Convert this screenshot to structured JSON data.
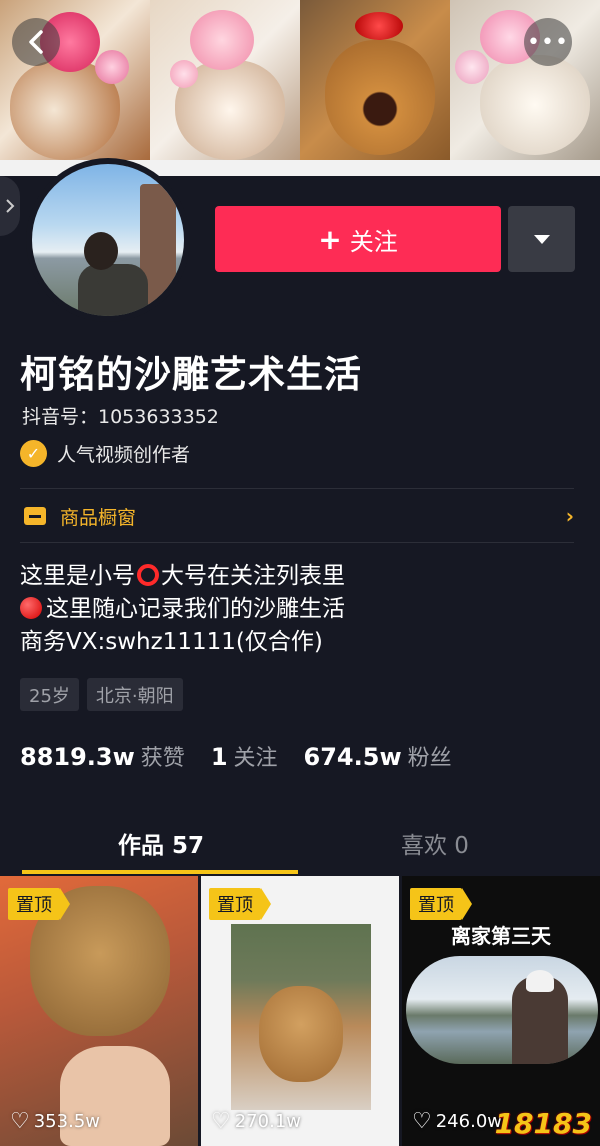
{
  "header": {
    "back_icon": "chevron-left-icon",
    "more_icon": "more-dots-icon",
    "more_glyph": "•••"
  },
  "profile": {
    "name": "柯铭的沙雕艺术生活",
    "douyin_id": "抖音号：1053633352",
    "badge": "人气视频创作者",
    "follow_label": "关注",
    "follow_plus": "+",
    "shop_label": "商品橱窗",
    "bio_line1_a": "这里是小号",
    "bio_line1_b": "大号在关注列表里",
    "bio_line2": "这里随心记录我们的沙雕生活",
    "bio_line3": "商务VX:swhz11111(仅合作)",
    "tags": [
      "25岁",
      "北京·朝阳"
    ]
  },
  "stats": [
    {
      "num": "8819.3w",
      "label": "获赞"
    },
    {
      "num": "1",
      "label": "关注"
    },
    {
      "num": "674.5w",
      "label": "粉丝"
    }
  ],
  "tabs": {
    "works": "作品 57",
    "likes": "喜欢 0"
  },
  "videos": [
    {
      "pin": "置顶",
      "likes": "353.5w",
      "caption": ""
    },
    {
      "pin": "置顶",
      "likes": "270.1w",
      "caption": ""
    },
    {
      "pin": "置顶",
      "likes": "246.0w",
      "caption": "离家第三天"
    }
  ],
  "watermark": "18183",
  "colors": {
    "background": "#161823",
    "follow": "#fe2c55",
    "accent_yellow": "#f5c418",
    "badge": "#f5b52a"
  }
}
